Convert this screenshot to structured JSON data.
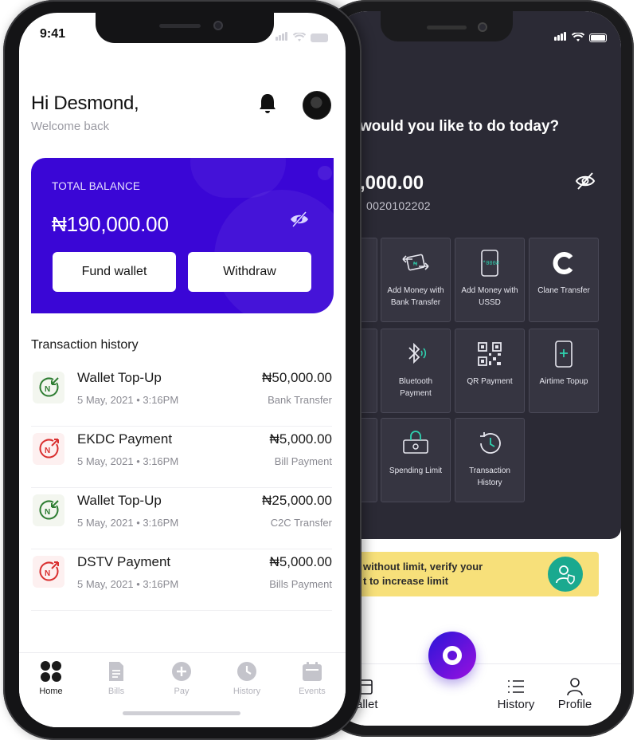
{
  "back_phone": {
    "question": "would you like to do today?",
    "balance": ",000.00",
    "account_number": "0020102202",
    "tiles": [
      {
        "label": "Add Money with Bank Transfer",
        "icon": "bank-transfer-icon"
      },
      {
        "label": "Add Money with USSD",
        "icon": "ussd-phone-icon"
      },
      {
        "label": "Clane Transfer",
        "icon": "clane-logo-icon"
      },
      {
        "label": "Bluetooth Payment",
        "icon": "bluetooth-icon"
      },
      {
        "label": "QR Payment",
        "icon": "qr-code-icon"
      },
      {
        "label": "Airtime Topup",
        "icon": "airtime-phone-icon"
      },
      {
        "label": "Spending Limit",
        "icon": "spending-limit-icon"
      },
      {
        "label": "Transaction History",
        "icon": "history-clock-icon"
      }
    ],
    "verify_banner": {
      "line1": "without limit, verify your",
      "line2": "t to increase limit"
    },
    "nav": [
      {
        "label": "Wallet",
        "icon": "wallet-icon"
      },
      {
        "label": "History",
        "icon": "list-icon"
      },
      {
        "label": "Profile",
        "icon": "profile-icon"
      }
    ],
    "colors": {
      "dark_bg": "#2b2a35",
      "banner": "#f7e07a",
      "badge": "#1aa98f"
    }
  },
  "front_phone": {
    "status_time": "9:41",
    "greeting": "Hi Desmond,",
    "welcome": "Welcome back",
    "card": {
      "label": "TOTAL BALANCE",
      "amount": "₦190,000.00",
      "fund_label": "Fund wallet",
      "withdraw_label": "Withdraw"
    },
    "transactions_heading": "Transaction history",
    "transactions": [
      {
        "title": "Wallet Top-Up",
        "date": "5 May, 2021 • 3:16PM",
        "amount": "₦50,000.00",
        "type": "Bank Transfer",
        "direction": "in"
      },
      {
        "title": "EKDC Payment",
        "date": "5 May, 2021 • 3:16PM",
        "amount": "₦5,000.00",
        "type": "Bill Payment",
        "direction": "out"
      },
      {
        "title": "Wallet Top-Up",
        "date": "5 May, 2021 • 3:16PM",
        "amount": "₦25,000.00",
        "type": "C2C Transfer",
        "direction": "in"
      },
      {
        "title": "DSTV Payment",
        "date": "5 May, 2021 • 3:16PM",
        "amount": "₦5,000.00",
        "type": "Bills Payment",
        "direction": "out"
      }
    ],
    "nav": [
      {
        "label": "Home",
        "icon": "home-grid-icon",
        "active": true
      },
      {
        "label": "Bills",
        "icon": "bills-document-icon",
        "active": false
      },
      {
        "label": "Pay",
        "icon": "pay-plus-icon",
        "active": false
      },
      {
        "label": "History",
        "icon": "history-clock-icon",
        "active": false
      },
      {
        "label": "Events",
        "icon": "events-calendar-icon",
        "active": false
      }
    ],
    "colors": {
      "card": "#3a06d6",
      "incoming": "#2e7d32",
      "outgoing": "#d93030"
    }
  }
}
